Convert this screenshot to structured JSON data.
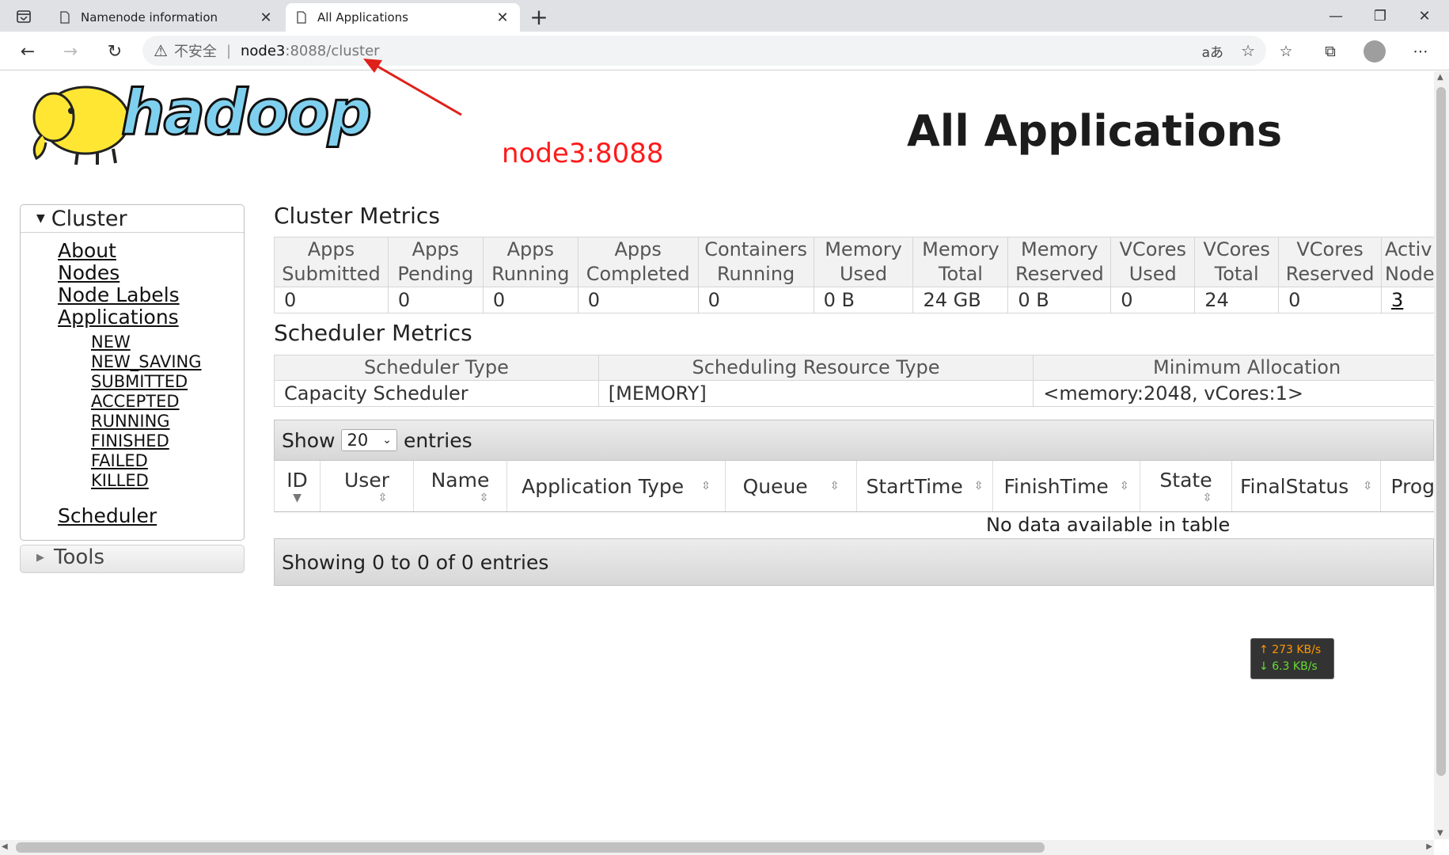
{
  "browser": {
    "tabs": [
      {
        "title": "Namenode information"
      },
      {
        "title": "All Applications"
      }
    ],
    "address": {
      "security": "不安全",
      "host": "node3",
      "path": ":8088/cluster"
    }
  },
  "page": {
    "heading": "All Applications",
    "logo": "hadoop",
    "annotation": "node3:8088"
  },
  "sidebar": {
    "cluster_label": "Cluster",
    "links": [
      "About",
      "Nodes",
      "Node Labels",
      "Applications"
    ],
    "app_states": [
      "NEW",
      "NEW_SAVING",
      "SUBMITTED",
      "ACCEPTED",
      "RUNNING",
      "FINISHED",
      "FAILED",
      "KILLED"
    ],
    "scheduler_link": "Scheduler",
    "tools_label": "Tools"
  },
  "cluster_metrics": {
    "title": "Cluster Metrics",
    "columns": [
      [
        "Apps",
        "Submitted"
      ],
      [
        "Apps",
        "Pending"
      ],
      [
        "Apps",
        "Running"
      ],
      [
        "Apps",
        "Completed"
      ],
      [
        "Containers",
        "Running"
      ],
      [
        "Memory",
        "Used"
      ],
      [
        "Memory",
        "Total"
      ],
      [
        "Memory",
        "Reserved"
      ],
      [
        "VCores",
        "Used"
      ],
      [
        "VCores",
        "Total"
      ],
      [
        "VCores",
        "Reserved"
      ],
      [
        "Activ",
        "Node"
      ]
    ],
    "values": [
      "0",
      "0",
      "0",
      "0",
      "0",
      "0 B",
      "24 GB",
      "0 B",
      "0",
      "24",
      "0",
      "3"
    ]
  },
  "scheduler_metrics": {
    "title": "Scheduler Metrics",
    "columns": [
      "Scheduler Type",
      "Scheduling Resource Type",
      "Minimum Allocation"
    ],
    "values": [
      "Capacity Scheduler",
      "[MEMORY]",
      "<memory:2048, vCores:1>"
    ]
  },
  "apps_table": {
    "show_label": "Show",
    "page_size": "20",
    "entries_label": "entries",
    "columns": [
      "ID",
      "User",
      "Name",
      "Application Type",
      "Queue",
      "StartTime",
      "FinishTime",
      "State",
      "FinalStatus",
      "Prog"
    ],
    "empty_message": "No data available in table",
    "footer": "Showing 0 to 0 of 0 entries"
  },
  "net_speed": {
    "up": "273 KB/s",
    "down": "6.3 KB/s"
  },
  "colors": {
    "annotation": "#ff1a1a",
    "logo_fill": "#7fd0ee",
    "up_speed": "#ff9900",
    "down_speed": "#66dd33"
  }
}
